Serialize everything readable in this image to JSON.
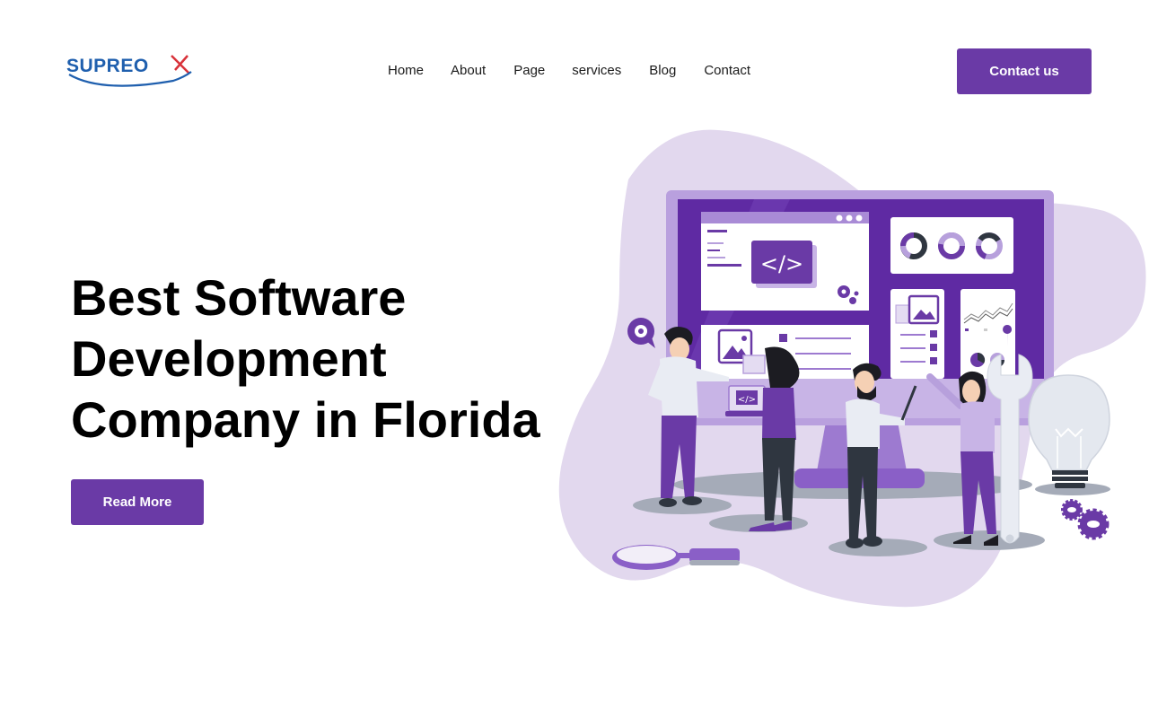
{
  "brand": {
    "name": "SUPREOX",
    "logo_main": "SUPREO",
    "logo_mark": "X",
    "colors": {
      "logo_blue": "#1f5fae",
      "logo_red": "#d8323a",
      "accent": "#6a3aa6",
      "blob": "#e2d8ee"
    }
  },
  "nav": {
    "items": [
      {
        "label": "Home"
      },
      {
        "label": "About"
      },
      {
        "label": "Page"
      },
      {
        "label": "services"
      },
      {
        "label": "Blog"
      },
      {
        "label": "Contact"
      }
    ]
  },
  "header": {
    "cta_label": "Contact us"
  },
  "hero": {
    "title_lines": [
      "Best Software",
      "Development",
      "Company in Florida"
    ],
    "button_label": "Read More"
  },
  "illustration": {
    "code_symbol": "</>",
    "laptop_code_symbol": "</>",
    "icons": [
      "monitor-icon",
      "code-icon",
      "gear-icon",
      "donut-chart-icon",
      "image-icon",
      "line-chart-icon",
      "location-pin-icon",
      "pie-chart-icon",
      "wrench-icon",
      "lightbulb-icon",
      "magnifier-icon",
      "gears-icon",
      "speech-bubble-gear-icon"
    ]
  }
}
